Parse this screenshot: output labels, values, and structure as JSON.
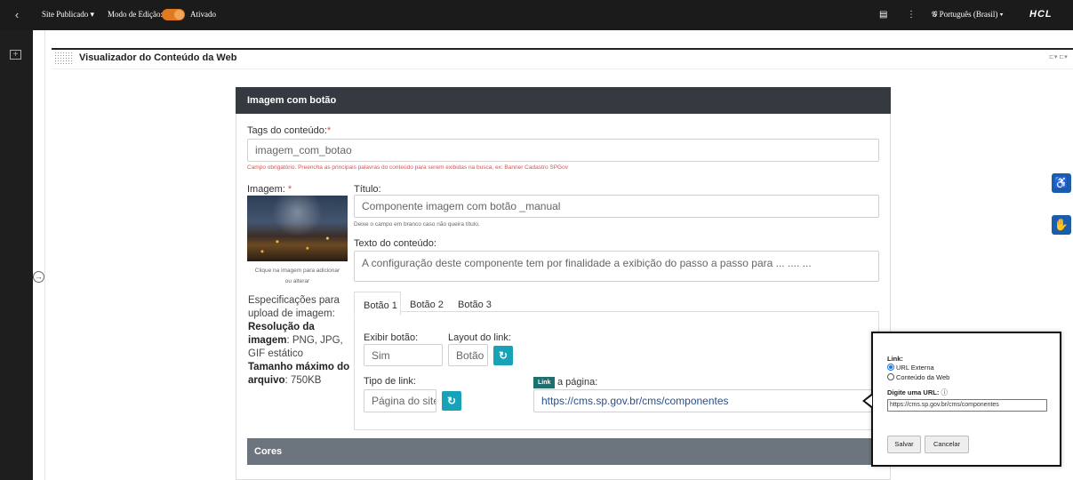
{
  "topbar": {
    "site_status": "Site Publicado",
    "edit_mode_label": "Modo de Edição:",
    "edit_mode_state": "Ativado",
    "language": "Português (Brasil)",
    "brand": "HCL",
    "accent_color": "#e07a20"
  },
  "portlet": {
    "title": "Visualizador do Conteúdo da Web",
    "actions": "⊏▾ ⊏▾"
  },
  "form": {
    "header": "Imagem com botão",
    "tags": {
      "label": "Tags do conteúdo:",
      "required_mark": "*",
      "value": "imagem_com_botao",
      "help": "Campo obrigatório. Preencha as principais palavras do conteúdo para serem exibidas na busca, ex: Banner Cadastro SPGov"
    },
    "image": {
      "label": "Imagem:",
      "required_mark": "*",
      "caption_line1": "Clique na imagem para adicionar",
      "caption_line2": "ou alterar"
    },
    "title_field": {
      "label": "Título:",
      "value": "Componente imagem com botão _manual",
      "help": "Deixe o campo em branco caso não queira título."
    },
    "text_field": {
      "label": "Texto do conteúdo:",
      "value": "A configuração deste componente tem por finalidade a exibição do passo a passo para ... .... ..."
    },
    "specs": {
      "intro": "Especificações para upload de imagem:",
      "resolution_label": "Resolução da imagem",
      "resolution_value": ": PNG, JPG, GIF estático",
      "size_label": "Tamanho máximo do arquivo",
      "size_value": ": 750KB"
    },
    "tabs": [
      {
        "label": "Botão 1",
        "active": true
      },
      {
        "label": "Botão 2",
        "active": false
      },
      {
        "label": "Botão 3",
        "active": false
      }
    ],
    "button_tab": {
      "show_label": "Exibir botão:",
      "show_value": "Sim",
      "layout_label": "Layout do link:",
      "layout_value": "Botão",
      "link_type_label": "Tipo de link:",
      "link_type_value": "Página do site",
      "link_badge": "Link",
      "page_label": "a página:",
      "page_value": "https://cms.sp.gov.br/cms/componentes"
    },
    "cores_label": "Cores",
    "refresh_color": "#17a2b8"
  },
  "popup": {
    "title": "Link:",
    "option_external": "URL Externa",
    "option_web_content": "Conteúdo da Web",
    "selected": "URL Externa",
    "url_label": "Digite uma URL:",
    "url_value": "https://cms.sp.gov.br/cms/componentes",
    "save": "Salvar",
    "cancel": "Cancelar"
  }
}
